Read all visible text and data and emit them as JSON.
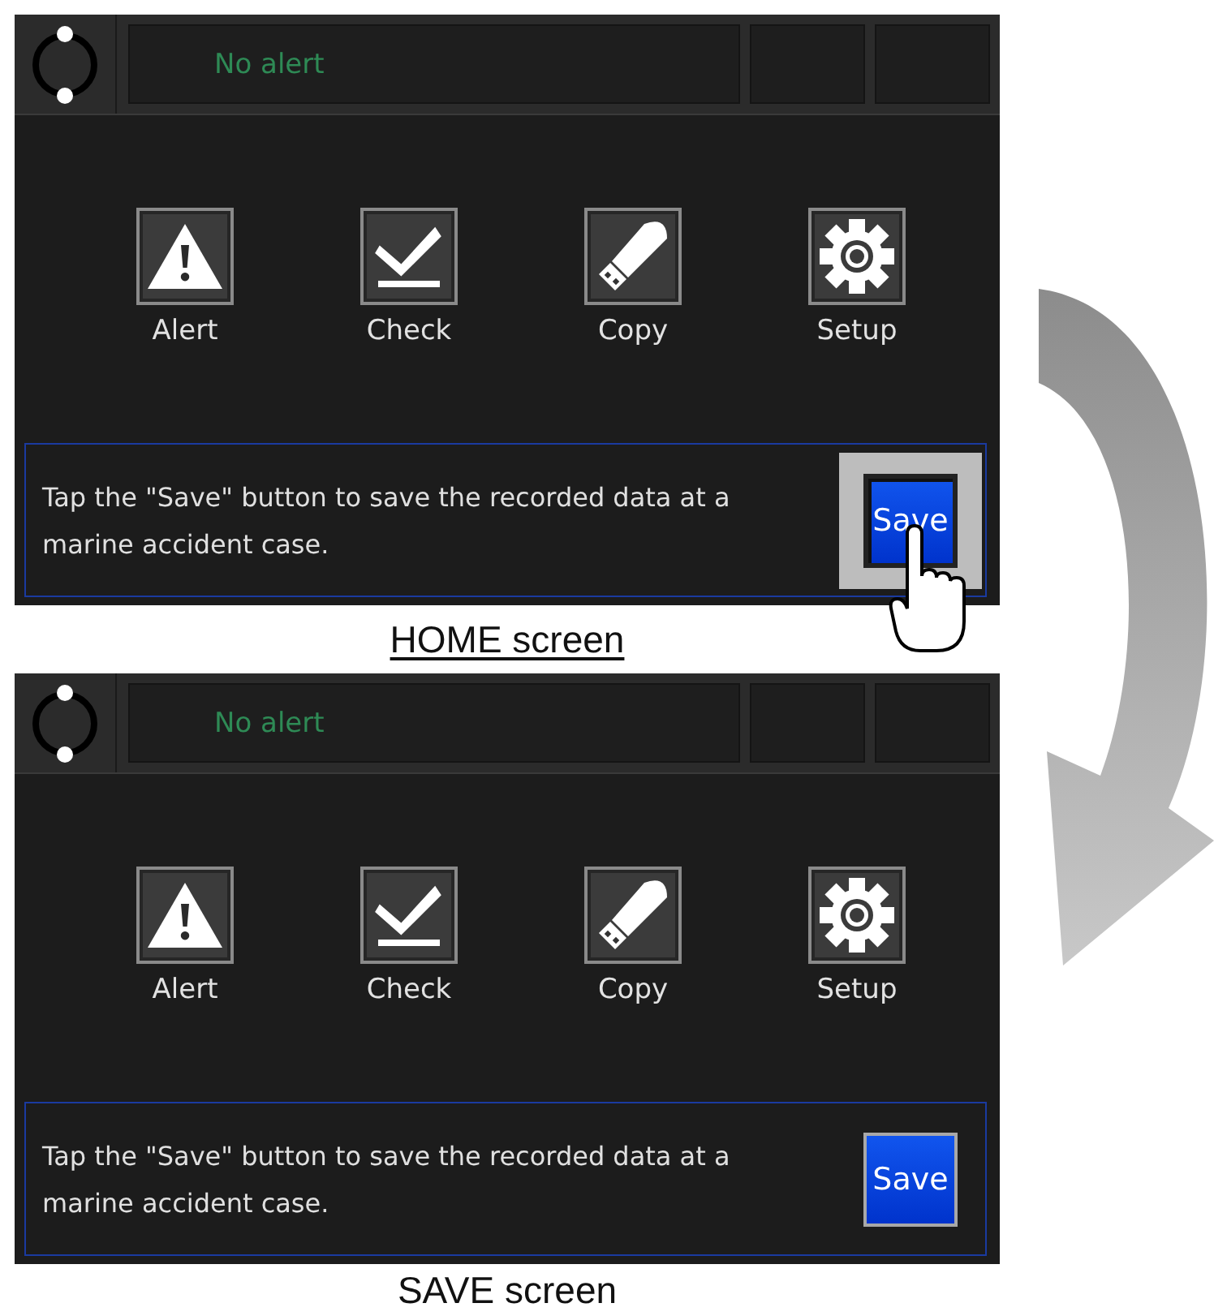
{
  "screens": [
    {
      "status": {
        "alert": "No alert"
      },
      "menu": [
        {
          "kind": "alert",
          "label": "Alert"
        },
        {
          "kind": "check",
          "label": "Check"
        },
        {
          "kind": "copy",
          "label": "Copy"
        },
        {
          "kind": "setup",
          "label": "Setup"
        }
      ],
      "message": "Tap the \"Save\" button to save the recorded data at a marine accident case.",
      "save_button": {
        "label": "Save",
        "pressed": true
      },
      "caption": {
        "text": "HOME screen",
        "underlined": true
      }
    },
    {
      "status": {
        "alert": "No alert"
      },
      "menu": [
        {
          "kind": "alert",
          "label": "Alert"
        },
        {
          "kind": "check",
          "label": "Check"
        },
        {
          "kind": "copy",
          "label": "Copy"
        },
        {
          "kind": "setup",
          "label": "Setup"
        }
      ],
      "message": "Tap the \"Save\" button to save the recorded data at a marine accident case.",
      "save_button": {
        "label": "Save",
        "pressed": false
      },
      "caption": {
        "text": "SAVE screen",
        "underlined": false
      }
    }
  ]
}
